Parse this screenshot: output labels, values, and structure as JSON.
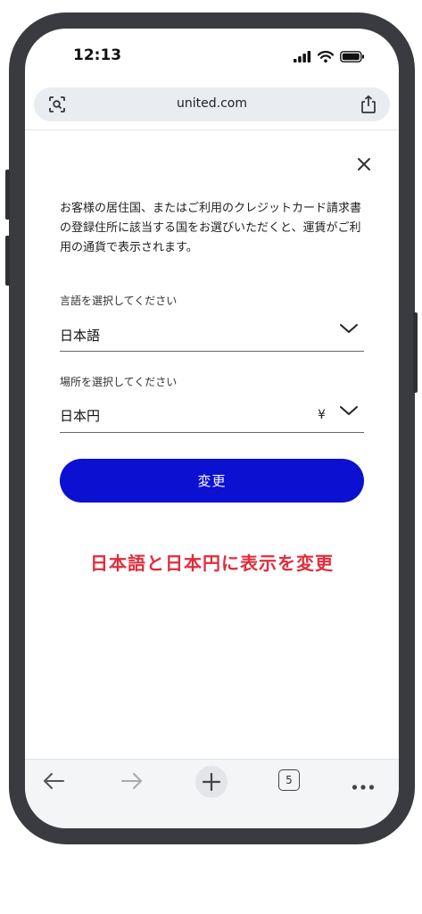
{
  "status_bar": {
    "time": "12:13"
  },
  "browser": {
    "url": "united.com",
    "tab_count": "5"
  },
  "dialog": {
    "notice_text": "お客様の居住国、またはご利用のクレジットカード請求書の登録住所に該当する国をお選びいただくと、運賃がご利用の通貨で表示されます。",
    "language_label": "言語を選択してください",
    "language_value": "日本語",
    "location_label": "場所を選択してください",
    "location_value": "日本円",
    "currency_symbol": "¥",
    "submit_label": "変更"
  },
  "annotation": "日本語と日本円に表示を変更",
  "colors": {
    "primary": "#0c10d1",
    "annotation": "#e02d3c",
    "shell": "#393b40"
  }
}
